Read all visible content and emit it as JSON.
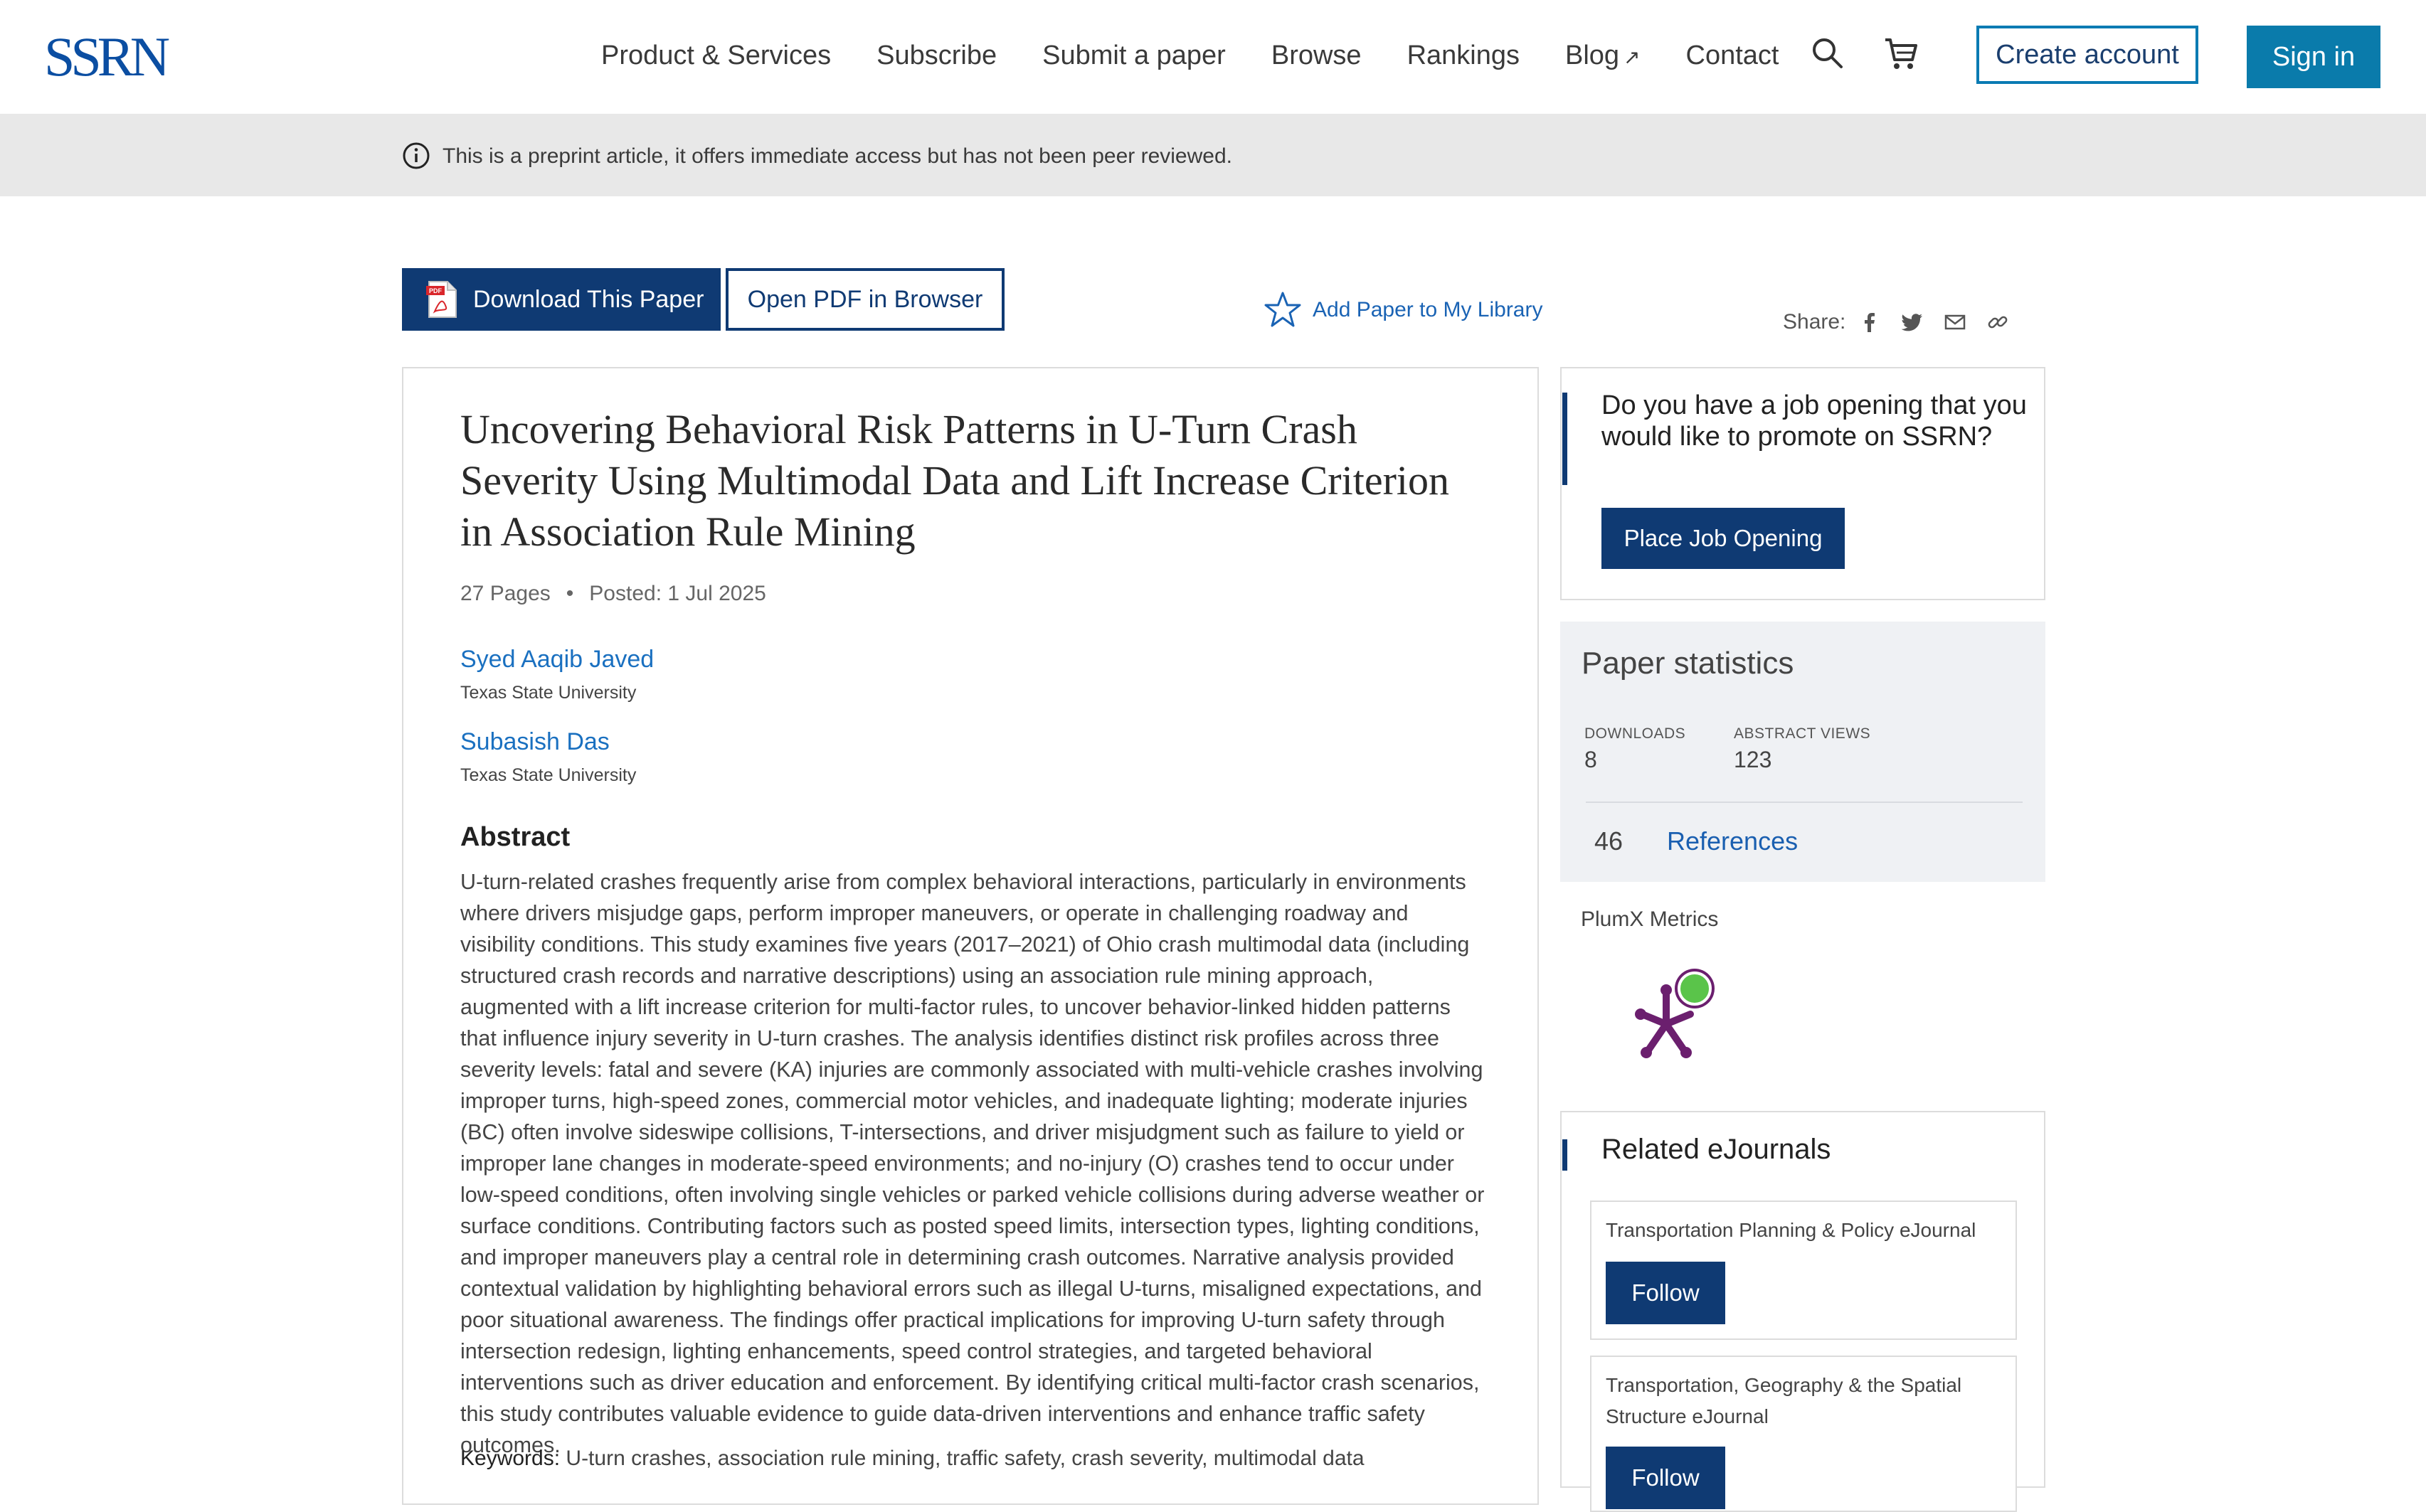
{
  "header": {
    "logo": "SSRN",
    "nav": [
      {
        "label": "Product & Services"
      },
      {
        "label": "Subscribe"
      },
      {
        "label": "Submit a paper"
      },
      {
        "label": "Browse"
      },
      {
        "label": "Rankings"
      },
      {
        "label": "Blog",
        "external_icon": "↗"
      },
      {
        "label": "Contact"
      }
    ],
    "search_icon": "search-icon",
    "cart_icon": "cart-icon",
    "create_account": "Create account",
    "sign_in": "Sign in"
  },
  "banner": {
    "icon": "info-icon",
    "text": "This is a preprint article, it offers immediate access but has not been peer reviewed."
  },
  "actions": {
    "download": "Download This Paper",
    "open_pdf": "Open PDF in Browser",
    "add_library": "Add Paper to My Library",
    "share_label": "Share:",
    "share_icons": [
      "facebook-icon",
      "twitter-icon",
      "email-icon",
      "link-icon"
    ]
  },
  "paper": {
    "title": "Uncovering Behavioral Risk Patterns in U-Turn Crash Severity Using Multimodal Data and Lift Increase Criterion in Association Rule Mining",
    "pages": "27 Pages",
    "posted": "Posted: 1 Jul 2025",
    "authors": [
      {
        "name": "Syed Aaqib Javed",
        "affiliation": "Texas State University"
      },
      {
        "name": "Subasish Das",
        "affiliation": "Texas State University"
      }
    ],
    "abstract_heading": "Abstract",
    "abstract": "U-turn-related crashes frequently arise from complex behavioral interactions, particularly in environments where drivers misjudge gaps, perform improper maneuvers, or operate in challenging roadway and visibility conditions. This study examines five years (2017–2021) of Ohio crash multimodal data (including structured crash records and narrative descriptions) using an association rule mining approach, augmented with a lift increase criterion for multi-factor rules, to uncover behavior-linked hidden patterns that influence injury severity in U-turn crashes. The analysis identifies distinct risk profiles across three severity levels: fatal and severe (KA) injuries are commonly associated with multi-vehicle crashes involving improper turns, high-speed zones, commercial motor vehicles, and inadequate lighting; moderate injuries (BC) often involve sideswipe collisions, T-intersections, and driver misjudgment such as failure to yield or improper lane changes in moderate-speed environments; and no-injury (O) crashes tend to occur under low-speed conditions, often involving single vehicles or parked vehicle collisions during adverse weather or surface conditions. Contributing factors such as posted speed limits, intersection types, lighting conditions, and improper maneuvers play a central role in determining crash outcomes. Narrative analysis provided contextual validation by highlighting behavioral errors such as illegal U-turns, misaligned expectations, and poor situational awareness. The findings offer practical implications for improving U-turn safety through intersection redesign, lighting enhancements, speed control strategies, and targeted behavioral interventions such as driver education and enforcement. By identifying critical multi-factor crash scenarios, this study contributes valuable evidence to guide data-driven interventions and enhance traffic safety outcomes.",
    "keywords_label": "Keywords:",
    "keywords": "U-turn crashes, association rule mining, traffic safety, crash severity, multimodal data"
  },
  "sidebar": {
    "job_question": "Do you have a job opening that you would like to promote on SSRN?",
    "job_button": "Place Job Opening",
    "stats_heading": "Paper statistics",
    "downloads_label": "DOWNLOADS",
    "downloads": "8",
    "views_label": "ABSTRACT VIEWS",
    "views": "123",
    "references_count": "46",
    "references_label": "References",
    "plumx_label": "PlumX Metrics",
    "journals_heading": "Related eJournals",
    "journals": [
      {
        "name": "Transportation Planning & Policy eJournal",
        "follow": "Follow"
      },
      {
        "name": "Transportation, Geography & the Spatial Structure eJournal",
        "follow": "Follow"
      }
    ]
  },
  "colors": {
    "brand_blue": "#0f3a73",
    "link_blue": "#1a70c0",
    "sign_in_teal": "#0a7bab",
    "plumx_purple": "#6b1f6e",
    "plumx_green": "#5ac44a"
  }
}
